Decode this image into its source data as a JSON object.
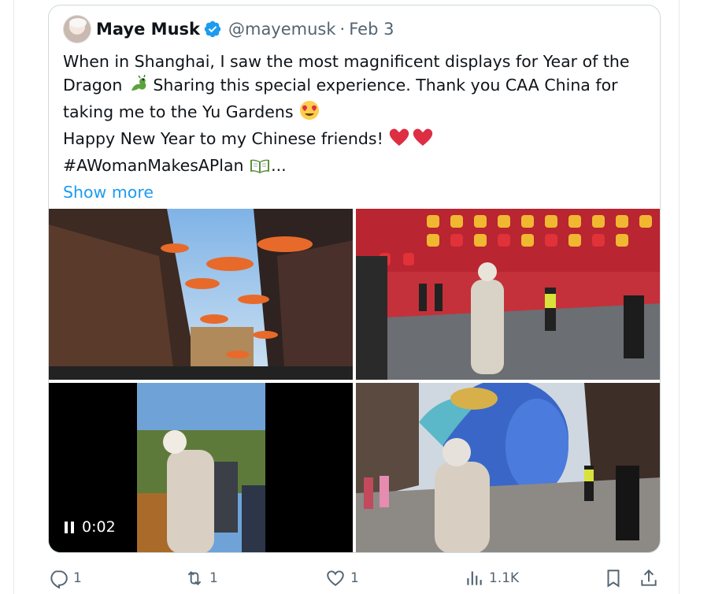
{
  "tweet": {
    "author_name": "Maye Musk",
    "handle": "@mayemusk",
    "separator": "·",
    "date": "Feb 3",
    "lines": [
      "When in Shanghai, I saw the most magnificent displays for Year of the",
      "Dragon",
      "Sharing this special experience. Thank you CAA China for",
      "taking me to the Yu Gardens",
      "Happy New Year to my Chinese friends!",
      "#AWomanMakesAPlan",
      "..."
    ],
    "emojis": {
      "dragon": "🐉",
      "heart_eyes": "😍",
      "hearts": "❤❤",
      "book": "📖"
    },
    "show_more": "Show more"
  },
  "media": {
    "video_time": "0:02"
  },
  "actions": {
    "replies": "1",
    "reposts": "1",
    "likes": "1",
    "views": "1.1K"
  },
  "colors": {
    "accent": "#1d9bf0",
    "muted": "#536471",
    "text": "#0f1419",
    "border": "#cfd9de"
  }
}
